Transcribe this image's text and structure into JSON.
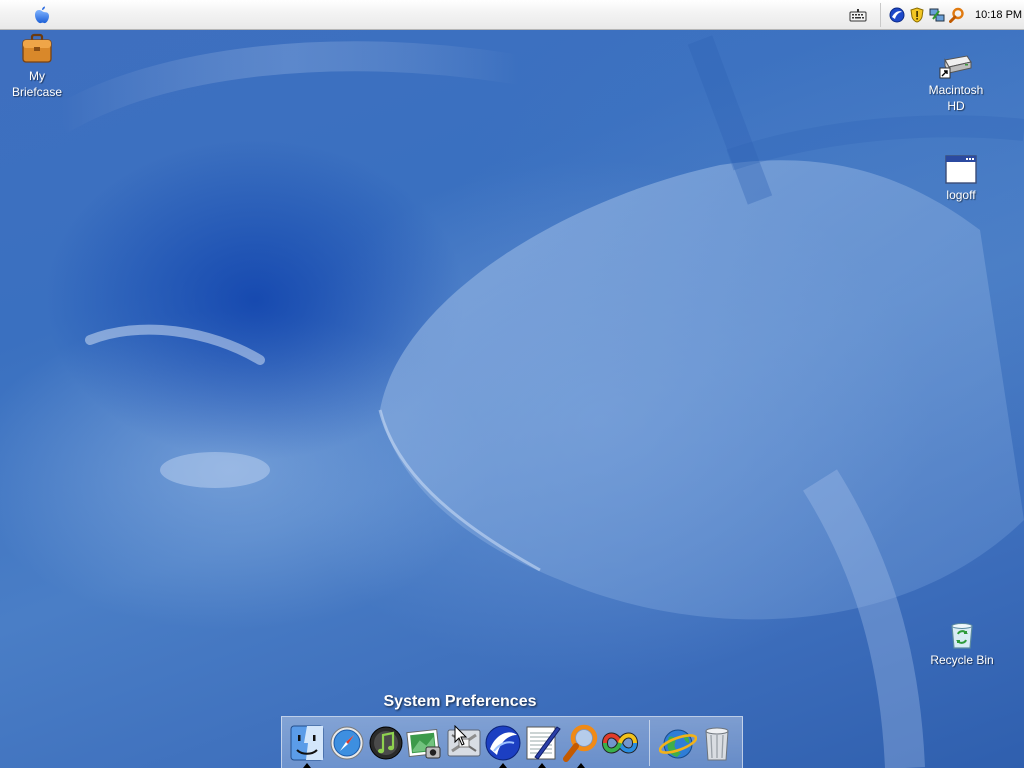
{
  "menubar": {
    "apple_menu_icon": "apple-icon",
    "keyboard_icon": "keyboard-icon",
    "tray_icons": [
      "seamonkey-icon",
      "security-shield-icon",
      "network-icon",
      "search-magnifier-icon"
    ],
    "clock": "10:18 PM"
  },
  "desktop": {
    "icons": [
      {
        "label_line1": "My",
        "label_line2": "Briefcase",
        "icon": "briefcase-icon"
      },
      {
        "label_line1": "Macintosh",
        "label_line2": "HD",
        "icon": "hard-drive-icon"
      },
      {
        "label_line1": "logoff",
        "label_line2": "",
        "icon": "window-icon"
      },
      {
        "label_line1": "Recycle Bin",
        "label_line2": "",
        "icon": "recycle-bin-icon"
      }
    ]
  },
  "dock": {
    "tooltip": "System Preferences",
    "items": [
      {
        "name": "Finder",
        "icon": "finder-icon",
        "running": true
      },
      {
        "name": "Safari",
        "icon": "safari-compass-icon",
        "running": false
      },
      {
        "name": "iTunes",
        "icon": "itunes-icon",
        "running": false
      },
      {
        "name": "iPhoto",
        "icon": "iphoto-icon",
        "running": false
      },
      {
        "name": "System Preferences",
        "icon": "system-preferences-icon",
        "running": false
      },
      {
        "name": "SeaMonkey",
        "icon": "seamonkey-icon",
        "running": true
      },
      {
        "name": "TextEdit",
        "icon": "textedit-icon",
        "running": true
      },
      {
        "name": "Sherlock",
        "icon": "sherlock-magnifier-icon",
        "running": true
      },
      {
        "name": "Windows Media",
        "icon": "media-player-icon",
        "running": false
      },
      {
        "name": "Internet Explorer",
        "icon": "internet-globe-icon",
        "running": false
      },
      {
        "name": "Trash",
        "icon": "trash-icon",
        "running": false
      }
    ]
  },
  "colors": {
    "wallpaper_base": "#3a70c0",
    "label_text": "#ffffff",
    "menubar_bg": "#f3f3f3"
  }
}
